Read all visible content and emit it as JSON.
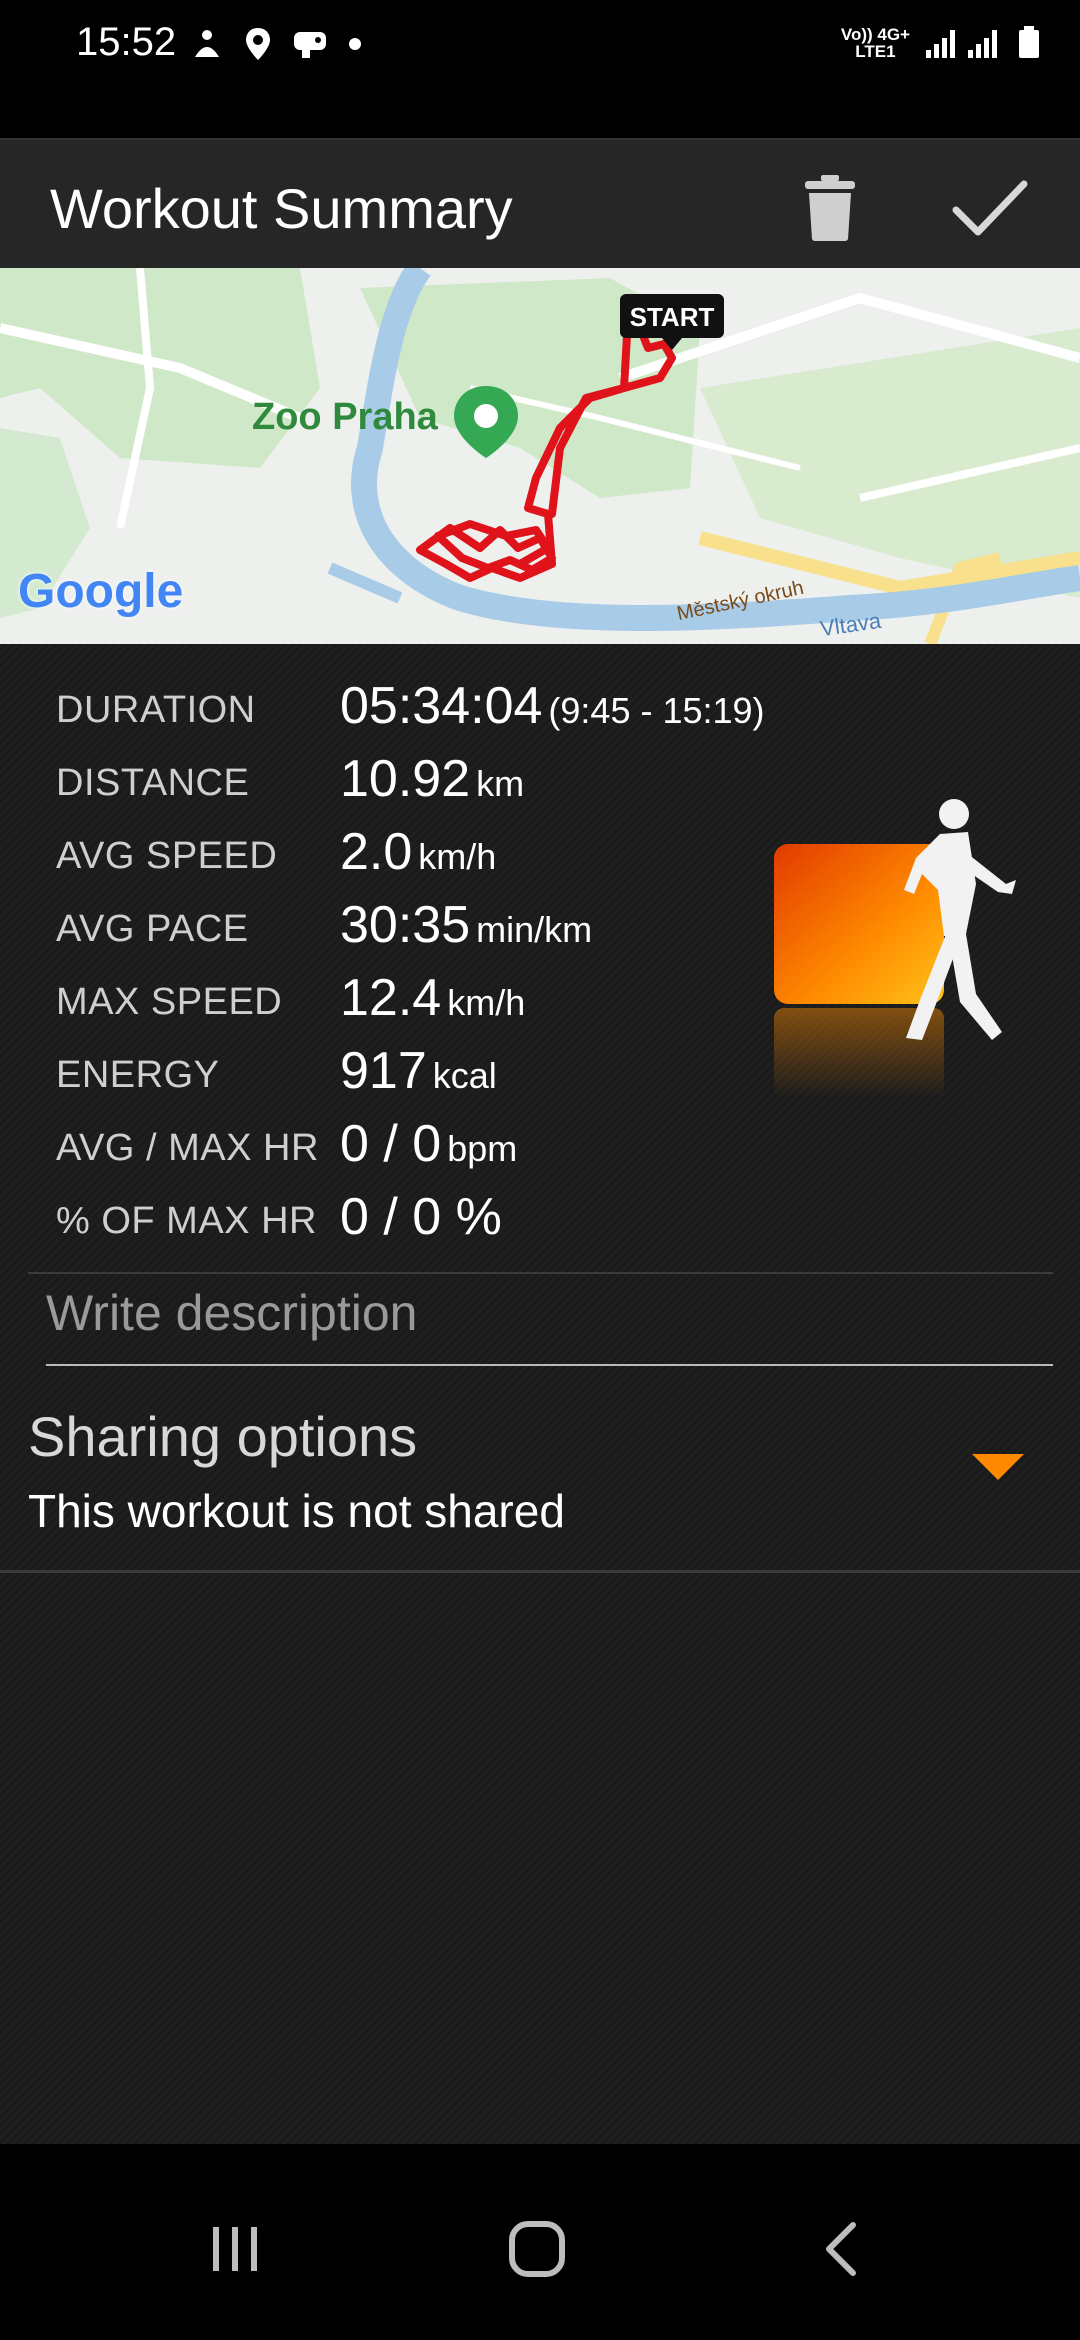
{
  "status_bar": {
    "time": "15:52",
    "network_line1": "Vo)) 4G+",
    "network_line2": "LTE1",
    "icons": [
      "pocket-cast-icon",
      "location-icon",
      "game-icon",
      "dot-icon",
      "signal-icon",
      "battery-icon"
    ]
  },
  "app_bar": {
    "title": "Workout Summary",
    "delete_icon": "trash-icon",
    "confirm_icon": "check-icon"
  },
  "map": {
    "place_label": "Zoo Praha",
    "start_label": "START",
    "provider": "Google",
    "road_label": "Městský okruh",
    "river_label": "Vltava"
  },
  "stats": [
    {
      "label": "DURATION",
      "value": "05:34:04",
      "unit": "(9:45 - 15:19)"
    },
    {
      "label": "DISTANCE",
      "value": "10.92",
      "unit": "km"
    },
    {
      "label": "AVG SPEED",
      "value": "2.0",
      "unit": "km/h"
    },
    {
      "label": "AVG PACE",
      "value": "30:35",
      "unit": "min/km"
    },
    {
      "label": "MAX SPEED",
      "value": "12.4",
      "unit": "km/h"
    },
    {
      "label": "ENERGY",
      "value": "917",
      "unit": "kcal"
    },
    {
      "label": "AVG / MAX HR",
      "value": "0 / 0",
      "unit": "bpm"
    },
    {
      "label": "% OF MAX HR",
      "value": "0 / 0 %",
      "unit": ""
    }
  ],
  "description": {
    "placeholder": "Write description"
  },
  "sharing": {
    "title": "Sharing options",
    "status": "This workout is not shared",
    "accent": "#ff8a00"
  },
  "colors": {
    "track": "#e0121a",
    "accent": "#ff8a00"
  },
  "nav_bar": {
    "icons": [
      "recent-apps-icon",
      "home-icon",
      "back-icon"
    ]
  }
}
